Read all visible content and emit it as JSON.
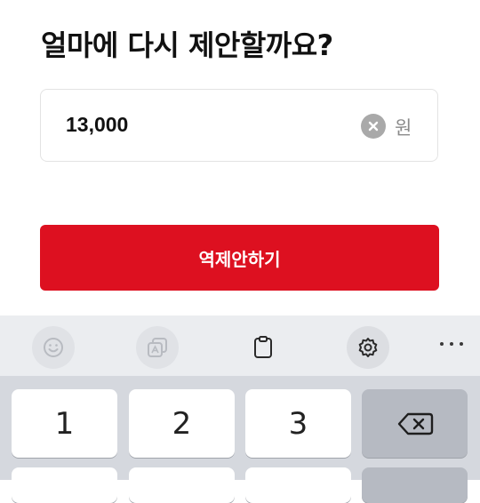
{
  "title": "얼마에 다시 제안할까요?",
  "price_input": {
    "value": "13,000",
    "unit": "원",
    "clear_icon": "clear-circle-x-icon"
  },
  "submit_button": {
    "label": "역제안하기",
    "color": "#dd1020"
  },
  "keyboard": {
    "toolbar_icons": [
      "emoji-icon",
      "image-edit-icon",
      "clipboard-icon",
      "settings-gear-icon",
      "more-dots-icon"
    ],
    "keys": [
      "1",
      "2",
      "3"
    ],
    "backspace_icon": "backspace-icon"
  }
}
